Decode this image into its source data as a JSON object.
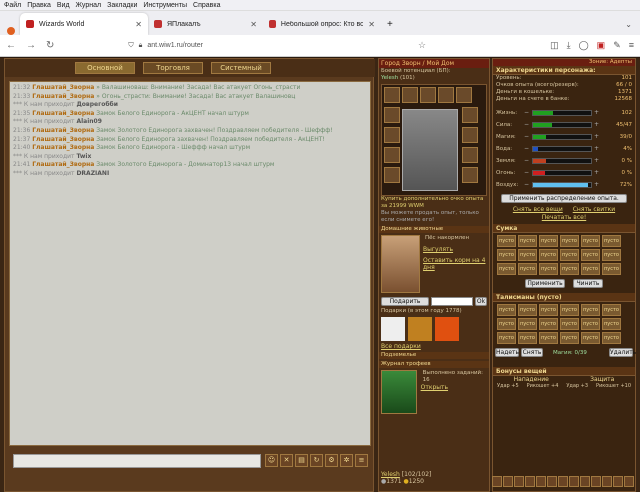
{
  "menu": [
    "Файл",
    "Правка",
    "Вид",
    "Журнал",
    "Закладки",
    "Инструменты",
    "Справка"
  ],
  "tabs": [
    {
      "label": "Wizards World",
      "color": "#c02020",
      "active": true
    },
    {
      "label": "ЯПлакалъ",
      "color": "#c03030",
      "active": false
    },
    {
      "label": "Небольшой опрос: Кто во что",
      "color": "#c03030",
      "active": false
    }
  ],
  "url": "ant.wiw1.ru/router",
  "chat_tabs": [
    "Основной",
    "Торговля",
    "Системный"
  ],
  "chat": [
    {
      "t": "21:32",
      "who": "Глашатай_Зворна",
      "msg": "» Валашиноваш: Внимание! Засада! Вас атакует Огонь_страсти"
    },
    {
      "t": "21:33",
      "who": "Глашатай_Зворна",
      "msg": "» Огонь_страсти: Внимание! Засада! Вас атакует Валашиновц"
    },
    {
      "t": "***",
      "who": "",
      "msg": "К нам приходит",
      "nick": "Доврегобби"
    },
    {
      "t": "21:35",
      "who": "Глашатай_Зворна",
      "msg": "Замок Белого Единорога - АкЦЕНТ начал штурм"
    },
    {
      "t": "***",
      "who": "",
      "msg": "К нам приходит",
      "nick": "Alain09"
    },
    {
      "t": "21:36",
      "who": "Глашатай_Зворна",
      "msg": "Замок Золотого Единорога захвачен! Поздравляем победителя - Шеффф!"
    },
    {
      "t": "21:37",
      "who": "Глашатай_Зворна",
      "msg": "Замок Белого Единорога захвачен! Поздравляем победителя - АкЦЕНТ!"
    },
    {
      "t": "21:40",
      "who": "Глашатай_Зворна",
      "msg": "Замок Белого Единорога - Шеффф начал штурм"
    },
    {
      "t": "***",
      "who": "",
      "msg": "К нам приходит",
      "nick": "Twix"
    },
    {
      "t": "21:41",
      "who": "Глашатай_Зворна",
      "msg": "Замок Золотого Единорога - Доминатор13 начал штурм"
    },
    {
      "t": "***",
      "who": "",
      "msg": "К нам приходит",
      "nick": "DRAZIANI"
    }
  ],
  "side": {
    "title": "Город Зворн / Мой Дом",
    "power": "Боевой потенциал (БП):",
    "nick": "Yelesh",
    "level": "(101)",
    "exp_info": "Купить дополнительно очко опыта за 21999 WWM",
    "note": "Вы можете продать опыт, только если снимете его!",
    "pets_hdr": "Домашние животные",
    "pet_status": "Пёс накормлен",
    "pet_walk": "Выгулять",
    "pet_food": "Оставить корм на 4 дня",
    "gift_btn": "Подарить",
    "gift_ok": "Ok",
    "gifts_hdr": "Подарки (в этом году 1778)",
    "gifts_link": "Все подарки",
    "dungeon_hdr": "Подземелье",
    "trophy_hdr": "Журнал трофеев",
    "trophy_done": "Выполнено заданий: 16",
    "trophy_open": "Открыть",
    "footer_nick": "Yelesh",
    "footer_lvl": "[102/102]",
    "footer_a": "1371",
    "footer_b": "1250"
  },
  "stats": {
    "zone": "Зоние: Адепты",
    "hdr": "Характеристики персонажа:",
    "rows": [
      [
        "Уровень:",
        "101"
      ],
      [
        "Очков опыта (всего/резерв):",
        "66 / 0"
      ],
      [
        "Деньги в кошельке:",
        "1371"
      ],
      [
        "Деньги на счете в банке:",
        "12568"
      ]
    ],
    "bars": [
      {
        "label": "Жизнь:",
        "val": "102",
        "color": "#20a020",
        "pct": 0.35
      },
      {
        "label": "Сила:",
        "val": "45/47",
        "color": "#20a020",
        "pct": 0.32
      },
      {
        "label": "Магия:",
        "val": "39/0",
        "color": "#20a020",
        "pct": 0.22
      },
      {
        "label": "Вода:",
        "val": "4%",
        "color": "#2050c0",
        "pct": 0.08
      },
      {
        "label": "Земля:",
        "val": "0 %",
        "color": "#c04020",
        "pct": 0.22
      },
      {
        "label": "Огонь:",
        "val": "0 %",
        "color": "#d02020",
        "pct": 0.2
      },
      {
        "label": "Воздух:",
        "val": "72%",
        "color": "#60c0f0",
        "pct": 0.95
      }
    ],
    "apply": "Применить распределение опыта.",
    "drop": "Снять все вещи",
    "drop2": "Снять свитки",
    "print": "Печатать все!",
    "bag_hdr": "Сумка",
    "empty": "пусто",
    "apply2": "Применить",
    "read": "Чинить",
    "tal_hdr": "Талисманы (пусто)",
    "tal_put": "Надеть",
    "tal_off": "Снять",
    "magic": "Магия: 0/39",
    "del": "Удалить",
    "bonus_hdr": "Бонусы вещей",
    "atk": "Нападение",
    "def": "Защита",
    "b1": "Удар +5",
    "b2": "Рикошет +4",
    "b3": "Удар +3",
    "b4": "Рикошет +10",
    "b5": "Крит +5",
    "b6": "Крит +5"
  }
}
